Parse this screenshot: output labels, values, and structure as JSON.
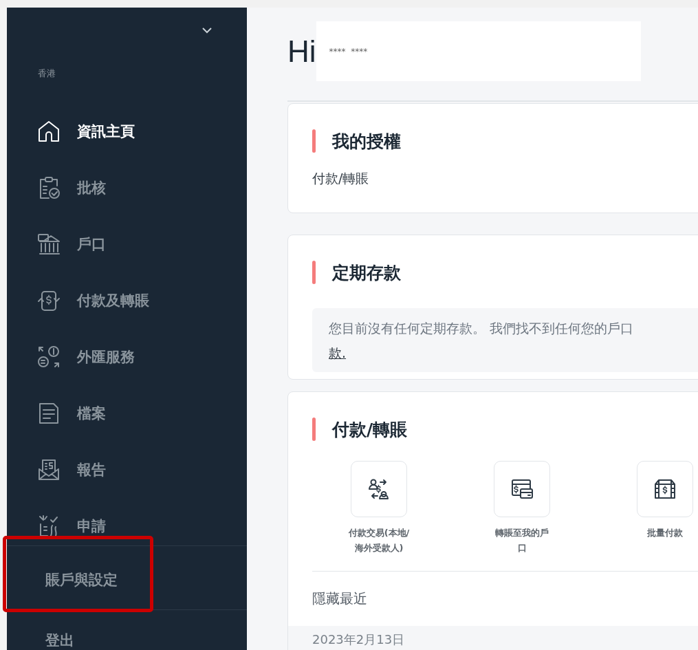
{
  "sidebar": {
    "region": "香港",
    "items": [
      {
        "label": "資訊主頁",
        "selected": true
      },
      {
        "label": "批核",
        "selected": false
      },
      {
        "label": "戶口",
        "selected": false
      },
      {
        "label": "付款及轉賬",
        "selected": false
      },
      {
        "label": "外匯服務",
        "selected": false
      },
      {
        "label": "檔案",
        "selected": false
      },
      {
        "label": "報告",
        "selected": false
      },
      {
        "label": "申請",
        "selected": false
      }
    ],
    "footer_items": [
      "賬戶與設定",
      "登出"
    ]
  },
  "greeting": {
    "prefix": "Hi",
    "masked_name": "****  ****"
  },
  "cards": [
    {
      "kind": "text",
      "title": "我的授權",
      "text": "付款/轉賬"
    },
    {
      "kind": "notice",
      "title": "定期存款",
      "message": "您目前沒有任何定期存款。 我們找不到任何您的戶口",
      "link": "款."
    },
    {
      "kind": "actions",
      "title": "付款/轉賬",
      "actions": [
        {
          "label_lines": [
            "付款交易(本地/",
            "海外受款人)"
          ]
        },
        {
          "label_lines": [
            "轉賬至我的戶",
            "口"
          ]
        },
        {
          "label_lines": [
            "批量付款"
          ]
        }
      ],
      "toggle": "隱藏最近",
      "date": "2023年2月13日"
    }
  ]
}
